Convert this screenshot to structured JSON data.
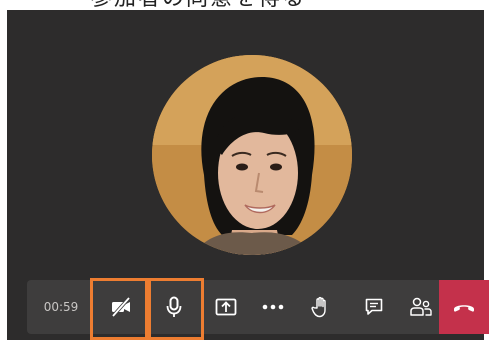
{
  "header": {
    "partial_caption": "ー参加者の同意を得る"
  },
  "participant": {
    "avatar_icon": "participant-photo"
  },
  "call_controls": {
    "timer": "00:59",
    "buttons": [
      {
        "name": "camera-toggle-button",
        "icon": "video-off-icon",
        "state": "off"
      },
      {
        "name": "mic-toggle-button",
        "icon": "microphone-icon",
        "state": "on"
      },
      {
        "name": "share-screen-button",
        "icon": "share-screen-icon"
      },
      {
        "name": "more-actions-button",
        "icon": "more-icon"
      },
      {
        "name": "raise-hand-button",
        "icon": "hand-icon"
      },
      {
        "name": "chat-button",
        "icon": "chat-icon"
      },
      {
        "name": "participants-button",
        "icon": "people-icon"
      },
      {
        "name": "leave-call-button",
        "icon": "hang-up-icon"
      }
    ]
  },
  "colors": {
    "stage_background": "#2d2c2c",
    "toolbar_background": "#3e3d3d",
    "hangup_red": "#c4314b",
    "highlight_orange": "#ed7d31",
    "icon_color": "#ffffff"
  }
}
